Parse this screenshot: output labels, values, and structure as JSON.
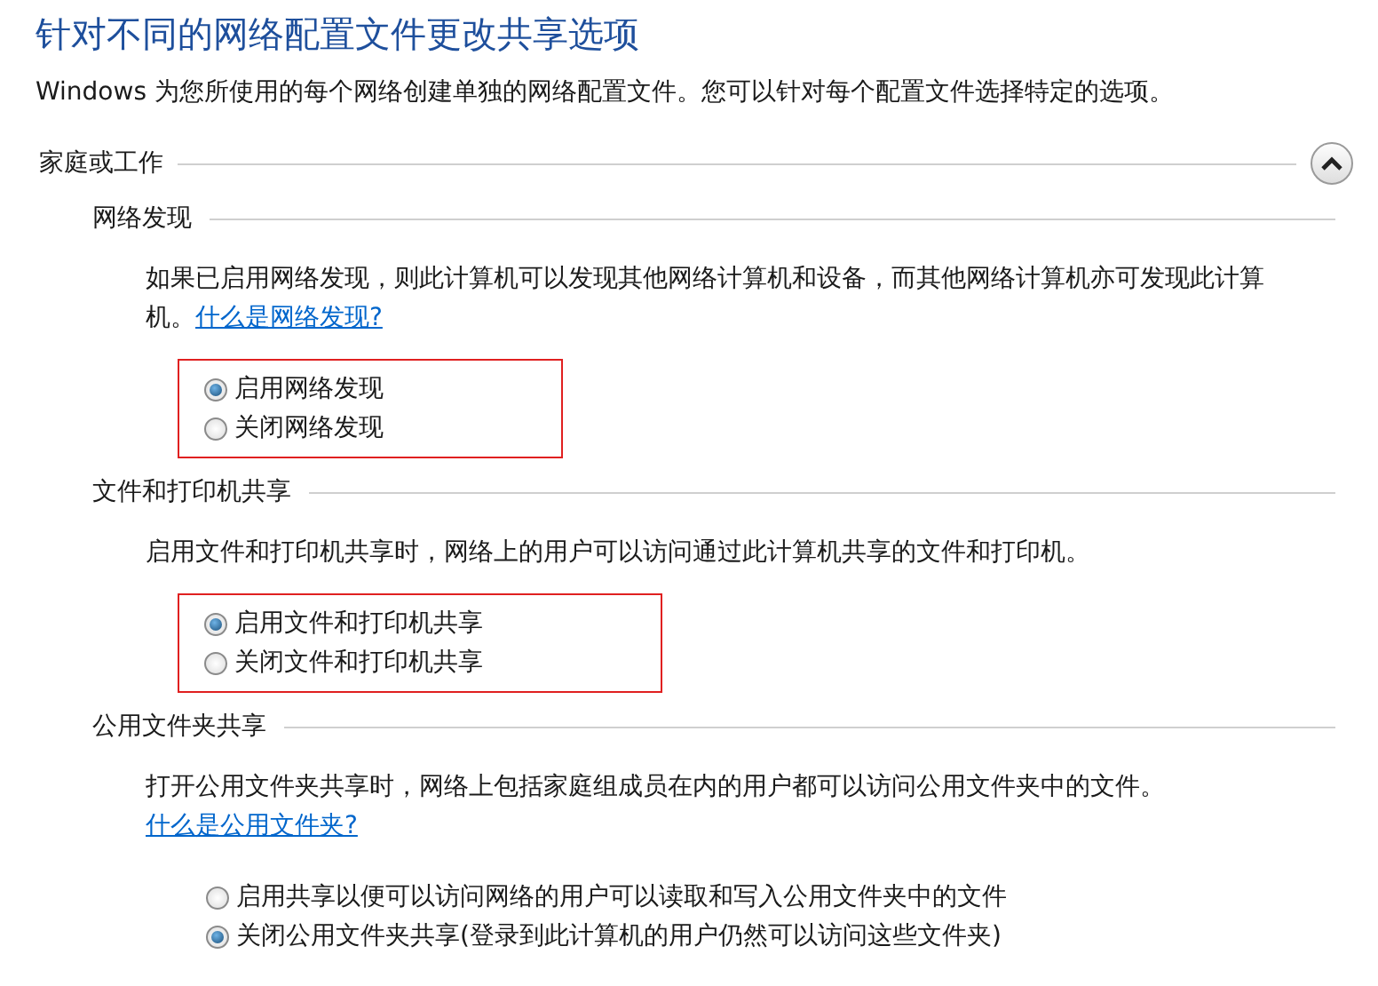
{
  "title": "针对不同的网络配置文件更改共享选项",
  "description": "Windows 为您所使用的每个网络创建单独的网络配置文件。您可以针对每个配置文件选择特定的选项。",
  "section": {
    "label": "家庭或工作",
    "expanded": true,
    "groups": [
      {
        "label": "网络发现",
        "text": "如果已启用网络发现，则此计算机可以发现其他网络计算机和设备，而其他网络计算机亦可发现此计算机。",
        "link": "什么是网络发现?",
        "highlighted": true,
        "options": [
          {
            "label": "启用网络发现",
            "selected": true
          },
          {
            "label": "关闭网络发现",
            "selected": false
          }
        ]
      },
      {
        "label": "文件和打印机共享",
        "text": "启用文件和打印机共享时，网络上的用户可以访问通过此计算机共享的文件和打印机。",
        "highlighted": true,
        "options": [
          {
            "label": "启用文件和打印机共享",
            "selected": true
          },
          {
            "label": "关闭文件和打印机共享",
            "selected": false
          }
        ]
      },
      {
        "label": "公用文件夹共享",
        "text": "打开公用文件夹共享时，网络上包括家庭组成员在内的用户都可以访问公用文件夹中的文件。",
        "link": "什么是公用文件夹?",
        "highlighted": false,
        "options": [
          {
            "label": "启用共享以便可以访问网络的用户可以读取和写入公用文件夹中的文件",
            "selected": false
          },
          {
            "label": "关闭公用文件夹共享(登录到此计算机的用户仍然可以访问这些文件夹)",
            "selected": true
          }
        ]
      }
    ]
  }
}
